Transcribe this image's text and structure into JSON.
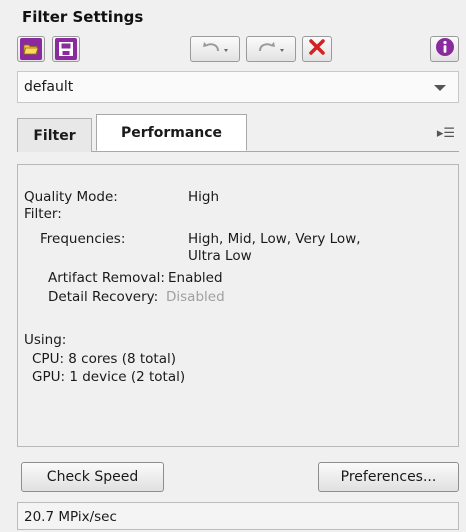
{
  "panel": {
    "title": "Filter Settings"
  },
  "toolbar": {
    "open_icon": "folder-open-icon",
    "save_icon": "save-disk-icon",
    "undo_icon": "undo-icon",
    "redo_icon": "redo-icon",
    "reset_icon": "red-x-icon",
    "info_icon": "info-icon",
    "accent_purple": "#8a2a9e",
    "accent_red": "#d42020"
  },
  "preset": {
    "value": "default"
  },
  "tabs": [
    {
      "label": "Filter",
      "selected": false
    },
    {
      "label": "Performance",
      "selected": true
    }
  ],
  "performance": {
    "quality_mode_label": "Quality Mode:",
    "quality_mode_value": "High",
    "filter_label": "Filter:",
    "frequencies_label": "Frequencies:",
    "frequencies_value_1": "High, Mid, Low, Very Low,",
    "frequencies_value_2": "Ultra Low",
    "artifact_label": "Artifact Removal:",
    "artifact_value": "Enabled",
    "detail_label": "Detail Recovery:",
    "detail_value": "Disabled",
    "using_label": "Using:",
    "cpu_line": "CPU: 8 cores  (8 total)",
    "gpu_line": "GPU: 1 device (2 total)"
  },
  "buttons": {
    "check_speed": "Check Speed",
    "preferences": "Preferences..."
  },
  "status": {
    "speed": "20.7 MPix/sec"
  }
}
